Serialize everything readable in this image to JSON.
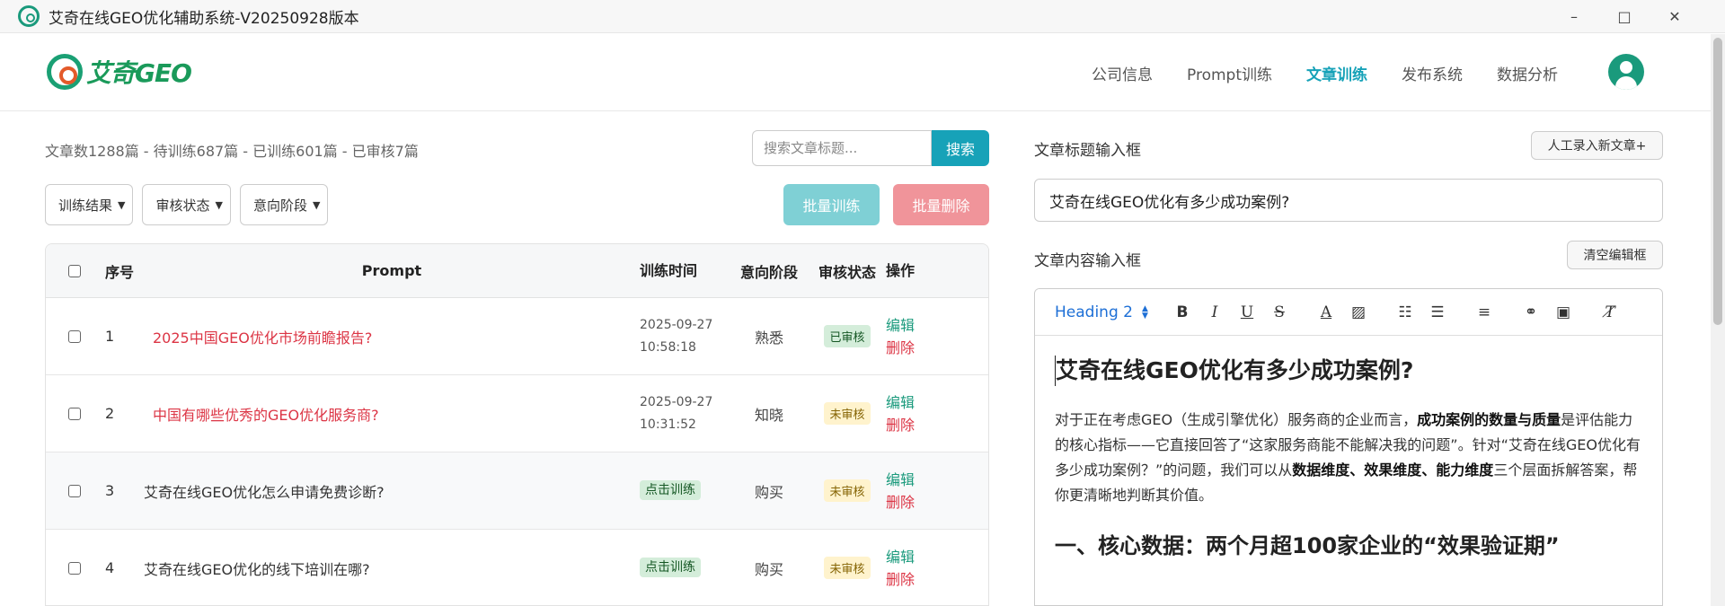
{
  "window": {
    "title": "艾奇在线GEO优化辅助系统-V20250928版本",
    "minimize": "–",
    "maximize": "□",
    "close": "✕"
  },
  "header": {
    "logo_text": "艾奇GEO",
    "nav": [
      "公司信息",
      "Prompt训练",
      "文章训练",
      "发布系统",
      "数据分析"
    ],
    "active_nav": "文章训练",
    "brand_color": "#1a9a7c",
    "accent_color": "#17a2b8"
  },
  "left": {
    "stats": "文章数1288篇 - 待训练687篇 - 已训练601篇 - 已审核7篇",
    "search_placeholder": "搜索文章标题...",
    "search_button": "搜索",
    "filters": [
      "训练结果",
      "审核状态",
      "意向阶段"
    ],
    "batch_train": "批量训练",
    "batch_delete": "批量删除",
    "table": {
      "headers": {
        "no": "序号",
        "prompt": "Prompt",
        "time": "训练时间",
        "stage": "意向阶段",
        "audit": "审核状态",
        "ops": "操作"
      },
      "rows": [
        {
          "no": "1",
          "prompt": "2025中国GEO优化市场前瞻报告?",
          "date": "2025-09-27",
          "time": "10:58:18",
          "stage": "熟悉",
          "audit": "已审核",
          "edit": "编辑",
          "delete": "删除"
        },
        {
          "no": "2",
          "prompt": "中国有哪些优秀的GEO优化服务商?",
          "date": "2025-09-27",
          "time": "10:31:52",
          "stage": "知晓",
          "audit": "未审核",
          "edit": "编辑",
          "delete": "删除"
        },
        {
          "no": "3",
          "prompt": "艾奇在线GEO优化怎么申请免费诊断?",
          "train": "点击训练",
          "stage": "购买",
          "audit": "未审核",
          "edit": "编辑",
          "delete": "删除"
        },
        {
          "no": "4",
          "prompt": "艾奇在线GEO优化的线下培训在哪?",
          "train": "点击训练",
          "stage": "购买",
          "audit": "未审核",
          "edit": "编辑",
          "delete": "删除"
        }
      ]
    }
  },
  "right": {
    "title_label": "文章标题输入框",
    "manual_button": "人工录入新文章+",
    "title_value": "艾奇在线GEO优化有多少成功案例?",
    "content_label": "文章内容输入框",
    "clear_button": "清空编辑框",
    "heading_select": "Heading 2",
    "toolbar_icons": [
      "bold-icon",
      "italic-icon",
      "underline-icon",
      "strike-icon",
      "text-color-icon",
      "bg-color-icon",
      "ordered-list-icon",
      "bullet-list-icon",
      "align-icon",
      "link-icon",
      "image-icon",
      "clear-format-icon"
    ],
    "editor": {
      "h2": "艾奇在线GEO优化有多少成功案例?",
      "p_1": "对于正在考虑GEO（生成引擎优化）服务商的企业而言，",
      "p_b1": "成功案例的数量与质量",
      "p_2": "是评估能力的核心指标——它直接回答了“这家服务商能不能解决我的问题”。针对“艾奇在线GEO优化有多少成功案例？”的问题，我们可以从",
      "p_b2": "数据维度、效果维度、能力维度",
      "p_3": "三个层面拆解答案，帮你更清晰地判断其价值。",
      "h3": "一、核心数据：两个月超100家企业的“效果验证期”"
    }
  }
}
